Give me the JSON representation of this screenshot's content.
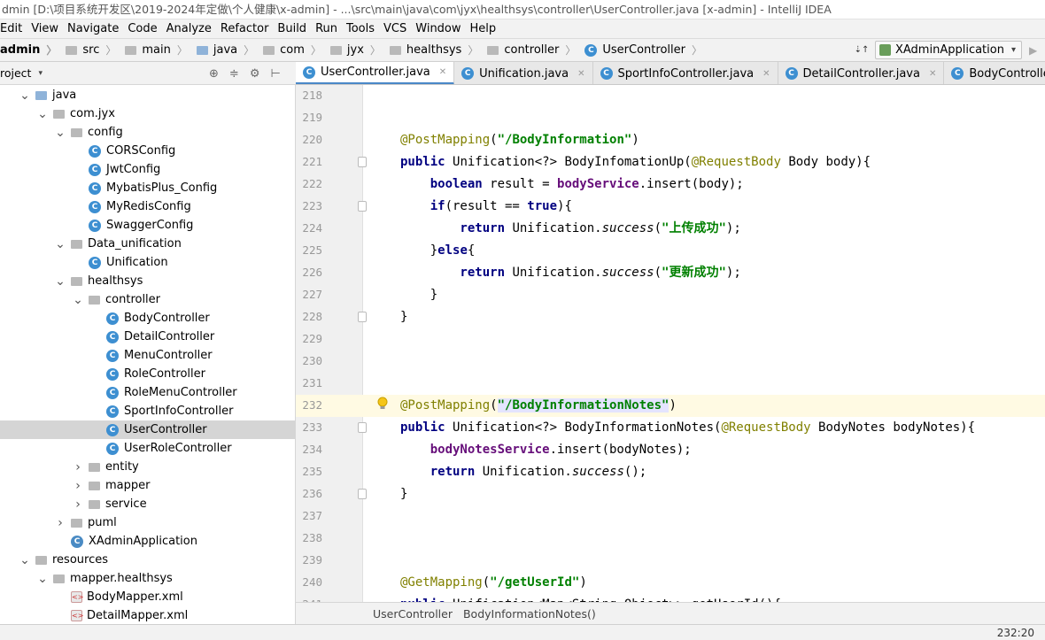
{
  "window": {
    "title": "dmin [D:\\项目系统开发区\\2019-2024年定做\\个人健康\\x-admin] - ...\\src\\main\\java\\com\\jyx\\healthsys\\controller\\UserController.java [x-admin] - IntelliJ IDEA"
  },
  "menu": [
    "Edit",
    "View",
    "Navigate",
    "Code",
    "Analyze",
    "Refactor",
    "Build",
    "Run",
    "Tools",
    "VCS",
    "Window",
    "Help"
  ],
  "navbar": {
    "crumbs": [
      "admin",
      "src",
      "main",
      "java",
      "com",
      "jyx",
      "healthsys",
      "controller",
      "UserController"
    ],
    "run_config": "XAdminApplication"
  },
  "project": {
    "title": "roject",
    "tree": [
      {
        "label": "java",
        "arrow": "down",
        "icon": "folder-blue"
      },
      {
        "label": "com.jyx",
        "arrow": "down",
        "icon": "folder"
      },
      {
        "label": "config",
        "arrow": "down",
        "icon": "folder"
      },
      {
        "label": "CORSConfig",
        "arrow": "none",
        "icon": "class"
      },
      {
        "label": "JwtConfig",
        "arrow": "none",
        "icon": "class"
      },
      {
        "label": "MybatisPlus_Config",
        "arrow": "none",
        "icon": "class"
      },
      {
        "label": "MyRedisConfig",
        "arrow": "none",
        "icon": "class"
      },
      {
        "label": "SwaggerConfig",
        "arrow": "none",
        "icon": "class"
      },
      {
        "label": "Data_unification",
        "arrow": "down",
        "icon": "folder"
      },
      {
        "label": "Unification",
        "arrow": "none",
        "icon": "class"
      },
      {
        "label": "healthsys",
        "arrow": "down",
        "icon": "folder"
      },
      {
        "label": "controller",
        "arrow": "down",
        "icon": "folder"
      },
      {
        "label": "BodyController",
        "arrow": "none",
        "icon": "class"
      },
      {
        "label": "DetailController",
        "arrow": "none",
        "icon": "class"
      },
      {
        "label": "MenuController",
        "arrow": "none",
        "icon": "class"
      },
      {
        "label": "RoleController",
        "arrow": "none",
        "icon": "class"
      },
      {
        "label": "RoleMenuController",
        "arrow": "none",
        "icon": "class"
      },
      {
        "label": "SportInfoController",
        "arrow": "none",
        "icon": "class"
      },
      {
        "label": "UserController",
        "arrow": "none",
        "icon": "class",
        "selected": true
      },
      {
        "label": "UserRoleController",
        "arrow": "none",
        "icon": "class"
      },
      {
        "label": "entity",
        "arrow": "right",
        "icon": "folder"
      },
      {
        "label": "mapper",
        "arrow": "right",
        "icon": "folder"
      },
      {
        "label": "service",
        "arrow": "right",
        "icon": "folder"
      },
      {
        "label": "puml",
        "arrow": "right",
        "icon": "folder"
      },
      {
        "label": "XAdminApplication",
        "arrow": "none",
        "icon": "app-class"
      },
      {
        "label": "resources",
        "arrow": "down",
        "icon": "folder"
      },
      {
        "label": "mapper.healthsys",
        "arrow": "down",
        "icon": "folder"
      },
      {
        "label": "BodyMapper.xml",
        "arrow": "none",
        "icon": "xml"
      },
      {
        "label": "DetailMapper.xml",
        "arrow": "none",
        "icon": "xml"
      }
    ]
  },
  "tabs": [
    {
      "label": "UserController.java",
      "active": true
    },
    {
      "label": "Unification.java",
      "active": false
    },
    {
      "label": "SportInfoController.java",
      "active": false
    },
    {
      "label": "DetailController.java",
      "active": false
    },
    {
      "label": "BodyController.java",
      "active": false
    }
  ],
  "editor": {
    "lines": [
      {
        "num": "218",
        "code": []
      },
      {
        "num": "219",
        "code": []
      },
      {
        "num": "220",
        "code": [
          {
            "t": "@PostMapping",
            "c": "ann"
          },
          {
            "t": "("
          },
          {
            "t": "\"/BodyInformation\"",
            "c": "str"
          },
          {
            "t": ")"
          }
        ]
      },
      {
        "num": "221",
        "fold": true,
        "code": [
          {
            "t": "public ",
            "c": "kw"
          },
          {
            "t": "Unification<?> BodyInfomationUp("
          },
          {
            "t": "@RequestBody",
            "c": "ann"
          },
          {
            "t": " Body body){"
          }
        ]
      },
      {
        "num": "222",
        "code": [
          {
            "t": "    boolean ",
            "c": "kw"
          },
          {
            "t": "result = "
          },
          {
            "t": "bodyService",
            "c": "fld"
          },
          {
            "t": ".insert(body);"
          }
        ]
      },
      {
        "num": "223",
        "fold": true,
        "code": [
          {
            "t": "    if",
            "c": "kw"
          },
          {
            "t": "(result == "
          },
          {
            "t": "true",
            "c": "kw"
          },
          {
            "t": "){"
          }
        ]
      },
      {
        "num": "224",
        "code": [
          {
            "t": "        return ",
            "c": "kw"
          },
          {
            "t": "Unification."
          },
          {
            "t": "success",
            "c": "ital"
          },
          {
            "t": "("
          },
          {
            "t": "\"上传成功\"",
            "c": "str"
          },
          {
            "t": ");"
          }
        ]
      },
      {
        "num": "225",
        "code": [
          {
            "t": "    }"
          },
          {
            "t": "else",
            "c": "kw"
          },
          {
            "t": "{"
          }
        ]
      },
      {
        "num": "226",
        "code": [
          {
            "t": "        return ",
            "c": "kw"
          },
          {
            "t": "Unification."
          },
          {
            "t": "success",
            "c": "ital"
          },
          {
            "t": "("
          },
          {
            "t": "\"更新成功\"",
            "c": "str"
          },
          {
            "t": ");"
          }
        ]
      },
      {
        "num": "227",
        "code": [
          {
            "t": "    }"
          }
        ]
      },
      {
        "num": "228",
        "fold": true,
        "code": [
          {
            "t": "}"
          }
        ]
      },
      {
        "num": "229",
        "code": []
      },
      {
        "num": "230",
        "code": []
      },
      {
        "num": "231",
        "code": []
      },
      {
        "num": "232",
        "current": true,
        "bulb": true,
        "code": [
          {
            "t": "@PostMapping",
            "c": "ann"
          },
          {
            "t": "("
          },
          {
            "t": "\"/BodyInformationNotes\"",
            "c": "str hl"
          },
          {
            "t": ")"
          }
        ]
      },
      {
        "num": "233",
        "fold": true,
        "code": [
          {
            "t": "public ",
            "c": "kw"
          },
          {
            "t": "Unification<?> BodyInformationNotes("
          },
          {
            "t": "@RequestBody",
            "c": "ann"
          },
          {
            "t": " BodyNotes bodyNotes){"
          }
        ]
      },
      {
        "num": "234",
        "code": [
          {
            "t": "    bodyNotesService",
            "c": "fld"
          },
          {
            "t": ".insert(bodyNotes);"
          }
        ]
      },
      {
        "num": "235",
        "code": [
          {
            "t": "    return ",
            "c": "kw"
          },
          {
            "t": "Unification."
          },
          {
            "t": "success",
            "c": "ital"
          },
          {
            "t": "();"
          }
        ]
      },
      {
        "num": "236",
        "fold": true,
        "code": [
          {
            "t": "}"
          }
        ]
      },
      {
        "num": "237",
        "code": []
      },
      {
        "num": "238",
        "code": []
      },
      {
        "num": "239",
        "code": []
      },
      {
        "num": "240",
        "code": [
          {
            "t": "@GetMapping",
            "c": "ann"
          },
          {
            "t": "("
          },
          {
            "t": "\"/getUserId\"",
            "c": "str"
          },
          {
            "t": ")"
          }
        ]
      },
      {
        "num": "241",
        "code": [
          {
            "t": "public ",
            "c": "kw"
          },
          {
            "t": "Unification<Map<String,Object>> getUserId(){"
          }
        ]
      }
    ]
  },
  "editor_breadcrumbs": [
    "UserController",
    "BodyInformationNotes()"
  ],
  "status": {
    "position": "232:20"
  }
}
